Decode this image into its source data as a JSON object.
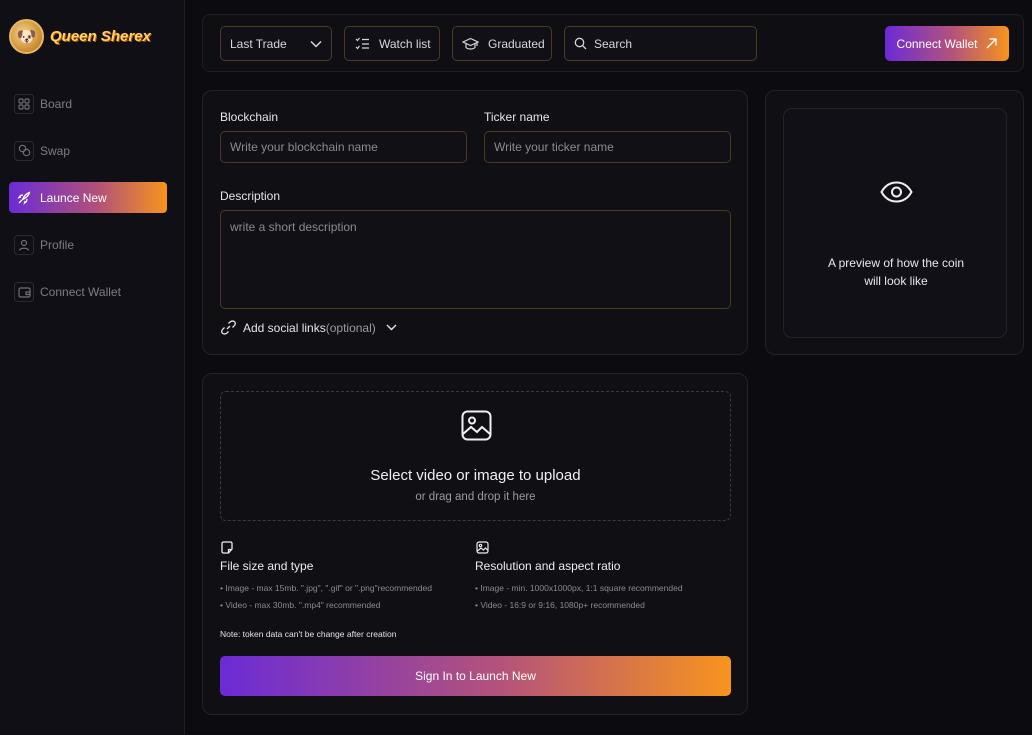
{
  "brand": {
    "name": "Queen Sherex"
  },
  "sidebar": {
    "items": [
      {
        "label": "Board",
        "icon": "grid-icon"
      },
      {
        "label": "Swap",
        "icon": "swap-icon"
      },
      {
        "label": "Launce New",
        "icon": "rocket-icon",
        "active": true
      },
      {
        "label": "Profile",
        "icon": "user-icon"
      },
      {
        "label": "Connect Wallet",
        "icon": "wallet-icon"
      }
    ]
  },
  "topbar": {
    "sort_select": "Last Trade",
    "watchlist_label": "Watch list",
    "graduated_label": "Graduated",
    "search_placeholder": "Search",
    "connect_label": "Connect Wallet"
  },
  "form": {
    "blockchain_label": "Blockchain",
    "blockchain_placeholder": "Write your blockchain name",
    "ticker_label": "Ticker name",
    "ticker_placeholder": "Write your ticker name",
    "description_label": "Description",
    "description_placeholder": "write a short description",
    "social_label": "Add social links",
    "social_optional": "(optional)"
  },
  "preview": {
    "text_line1": "A preview of how the coin",
    "text_line2": "will look like"
  },
  "upload": {
    "title": "Select video or image to upload",
    "subtitle": "or drag and drop it here",
    "file_title": "File size and type",
    "file_lines": [
      "• Image - max 15mb. \".jpg\", \".gif\" or \".png\"recommended",
      "• Video - max 30mb. \".mp4\" recommended"
    ],
    "res_title": "Resolution and aspect ratio",
    "res_lines": [
      "• Image - min. 1000x1000px, 1:1 square recommended",
      "• Video - 16:9 or 9:16, 1080p+ recommended"
    ],
    "note": "Note: token data can't be change after creation",
    "launch_label": "Sign In to Launch New"
  },
  "colors": {
    "accent_start": "#6b2bd6",
    "accent_end": "#f7941d",
    "border_gold": "#4a3a1f"
  }
}
